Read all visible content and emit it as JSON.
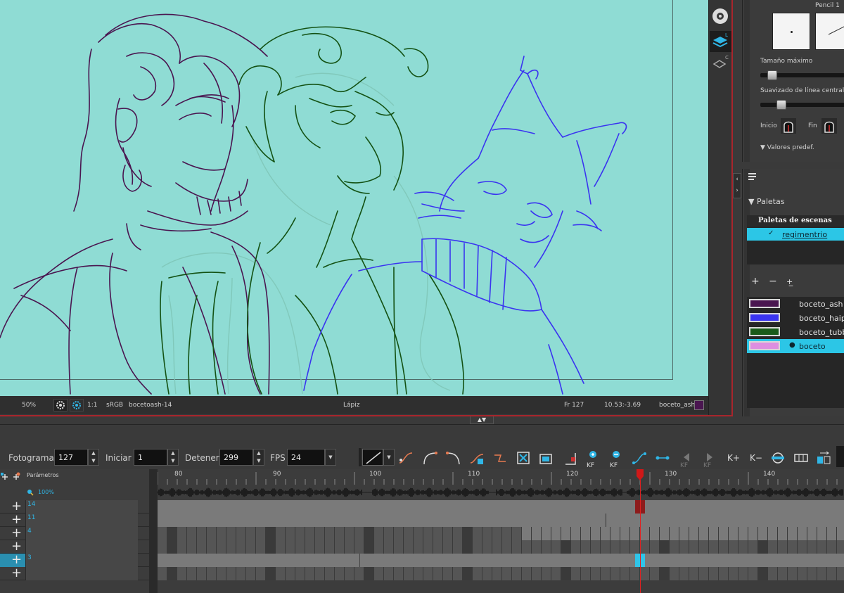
{
  "viewport": {
    "zoom": "50%",
    "ratio": "1:1",
    "color_space": "sRGB",
    "drawing_name": "bocetoash-14",
    "tool_name": "Lápiz",
    "frame": "Fr 127",
    "coords": "10.53:-3.69",
    "current_color_name": "boceto_ash",
    "current_color": "#4a1650"
  },
  "side_strip": {
    "layer_tag_l": "L",
    "layer_tag_c": "C"
  },
  "tool_properties": {
    "preset_name": "Pencil 1",
    "max_size_label": "Tamaño máximo",
    "smoothing_label": "Suavizado de línea central",
    "start_label": "Inicio",
    "end_label": "Fin",
    "presets_label": "Valores predef.",
    "max_size_level": 0.1,
    "smoothing_level": 0.2
  },
  "palette_panel": {
    "section_title": "Paletas",
    "scene_palettes_header": "Paletas de escenas",
    "selected_palette": "regimentrio",
    "swatches": [
      {
        "name": "boceto_ash",
        "color": "#4a1650"
      },
      {
        "name": "boceto_haip",
        "color": "#3a34f0"
      },
      {
        "name": "boceto_tubb",
        "color": "#1a5a1a"
      },
      {
        "name": "boceto",
        "color": "#dd8ee0",
        "selected": true
      }
    ]
  },
  "timeline_toolbar": {
    "frame_label": "Fotograma",
    "frame_value": "127",
    "start_label": "Iniciar",
    "start_value": "1",
    "stop_label": "Detener",
    "stop_value": "299",
    "fps_label": "FPS",
    "fps_value": "24",
    "kf_label": "KF"
  },
  "timeline": {
    "params_label": "Parámetros",
    "sound_zoom": "100%",
    "ruler_labels": [
      "80",
      "90",
      "100",
      "110",
      "120",
      "130",
      "140"
    ],
    "layers": [
      {
        "label": "14"
      },
      {
        "label": "11"
      },
      {
        "label": "4"
      },
      {
        "label": ""
      },
      {
        "label": "3"
      },
      {
        "label": ""
      }
    ],
    "current_frame": 127
  }
}
